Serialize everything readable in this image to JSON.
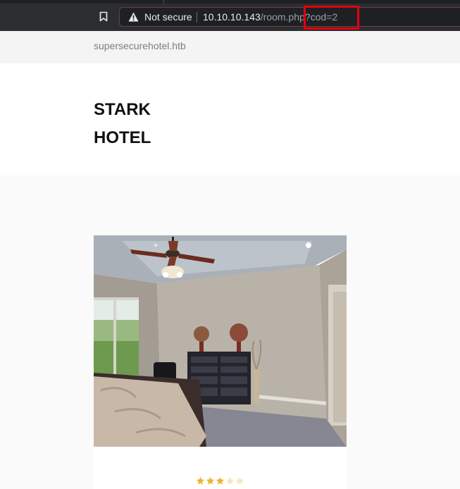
{
  "browser": {
    "security_label": "Not secure",
    "url_host": "10.10.10.143",
    "url_path": "/room.php",
    "url_query": "?cod=2",
    "highlight_color": "#e3000f"
  },
  "site": {
    "domain": "supersecurehotel.htb",
    "brand_line1": "STARK",
    "brand_line2": "HOTEL"
  },
  "room": {
    "rating_filled": 3,
    "rating_max": 5,
    "star_color": "#f0b32e",
    "star_empty_color": "#f6e6be"
  }
}
